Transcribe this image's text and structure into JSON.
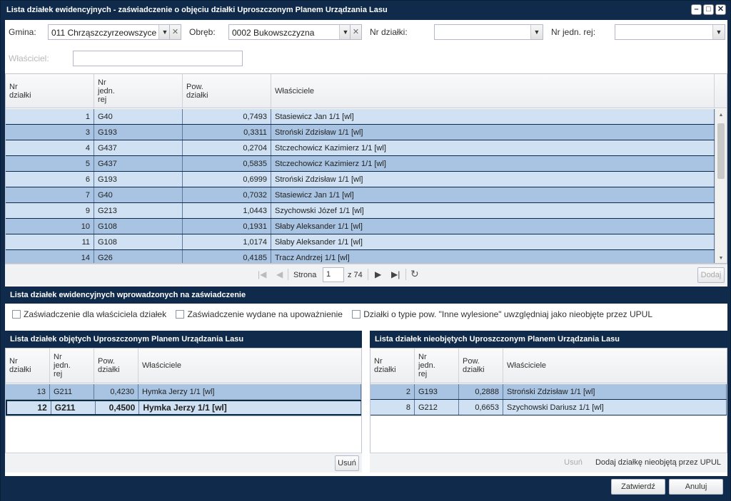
{
  "window": {
    "title": "Lista działek ewidencyjnych - zaświadczenie o objęciu działki Uproszczonym Planem Urządzania Lasu"
  },
  "filters": {
    "gmina_label": "Gmina:",
    "gmina_value": "011 Chrząszczyrzeowszyce",
    "obreb_label": "Obręb:",
    "obreb_value": "0002 Bukowszczyzna",
    "nr_dzialki_label": "Nr działki:",
    "nr_dzialki_value": "",
    "nr_jedn_label": "Nr jedn. rej:",
    "nr_jedn_value": "",
    "wlasciciel_label": "Właściciel:",
    "wlasciciel_value": ""
  },
  "main_grid": {
    "headers": [
      "Nr\ndziałki",
      "Nr\njedn.\nrej",
      "Pow.\ndziałki",
      "Właściciele"
    ],
    "rows": [
      [
        "1",
        "G40",
        "0,7493",
        "Stasiewicz Jan 1/1 [wl]"
      ],
      [
        "3",
        "G193",
        "0,3311",
        "Stroński Zdzisław 1/1 [wl]"
      ],
      [
        "4",
        "G437",
        "0,2704",
        "Stczechowicz Kazimierz 1/1 [wl]"
      ],
      [
        "5",
        "G437",
        "0,5835",
        "Stczechowicz Kazimierz 1/1 [wl]"
      ],
      [
        "6",
        "G193",
        "0,6999",
        "Stroński Zdzisław 1/1 [wl]"
      ],
      [
        "7",
        "G40",
        "0,7032",
        "Stasiewicz Jan 1/1 [wl]"
      ],
      [
        "9",
        "G213",
        "1,0443",
        "Szychowski Józef 1/1 [wl]"
      ],
      [
        "10",
        "G108",
        "0,1931",
        "Słaby Aleksander 1/1 [wl]"
      ],
      [
        "11",
        "G108",
        "1,0174",
        "Słaby Aleksander 1/1 [wl]"
      ],
      [
        "14",
        "G26",
        "0,4185",
        "Tracz Andrzej 1/1 [wl]"
      ]
    ]
  },
  "pager": {
    "page_label": "Strona",
    "page": "1",
    "of_label": "z 74",
    "add_label": "Dodaj"
  },
  "section": {
    "title": "Lista działek ewidencyjnych wprowadzonych na zaświadczenie",
    "cb1": "Zaświadczenie dla właściciela działek",
    "cb2": "Zaświadczenie wydane na upoważnienie",
    "cb3": "Działki o typie pow. \"Inne wylesione\" uwzględniaj jako nieobjęte przez UPUL"
  },
  "left_grid": {
    "title": "Lista działek objętych Uproszczonym Planem Urządzania Lasu",
    "headers": [
      "Nr\ndziałki",
      "Nr\njedn.\nrej",
      "Pow.\ndziałki",
      "Właściciele"
    ],
    "rows": [
      [
        "13",
        "G211",
        "0,4230",
        "Hymka Jerzy 1/1 [wl]"
      ],
      [
        "12",
        "G211",
        "0,4500",
        "Hymka Jerzy 1/1 [wl]"
      ]
    ],
    "remove_label": "Usuń"
  },
  "right_grid": {
    "title": "Lista działek nieobjętych Uproszczonym Planem Urządzania Lasu",
    "headers": [
      "Nr\ndziałki",
      "Nr\njedn.\nrej",
      "Pow.\ndziałki",
      "Właściciele"
    ],
    "rows": [
      [
        "2",
        "G193",
        "0,2888",
        "Stroński Zdzisław 1/1 [wl]"
      ],
      [
        "8",
        "G212",
        "0,6653",
        "Szychowski Dariusz 1/1 [wl]"
      ]
    ],
    "remove_label": "Usuń",
    "add_label": "Dodaj działkę nieobjętą przez UPUL"
  },
  "footer": {
    "confirm_label": "Zatwierdź",
    "cancel_label": "Anuluj"
  }
}
